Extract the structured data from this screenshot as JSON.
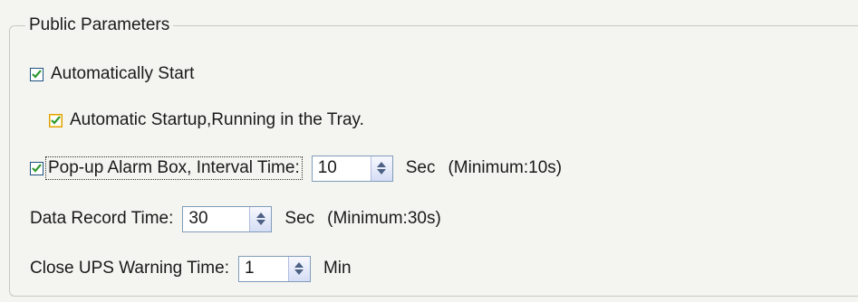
{
  "group_title": "Public Parameters",
  "auto_start": {
    "label": "Automatically Start",
    "checked": true
  },
  "auto_tray": {
    "label": "Automatic Startup,Running in the Tray.",
    "checked": true
  },
  "popup_alarm": {
    "label": "Pop-up Alarm Box, Interval Time:",
    "checked": true,
    "value": "10",
    "unit": "Sec",
    "note": "(Minimum:10s)"
  },
  "data_record": {
    "label": "Data Record Time:",
    "value": "30",
    "unit": "Sec",
    "note": "(Minimum:30s)"
  },
  "close_ups": {
    "label": "Close UPS Warning Time:",
    "value": "1",
    "unit": "Min"
  },
  "colors": {
    "check": "#2f9a2f",
    "border": "#7f9db9"
  }
}
